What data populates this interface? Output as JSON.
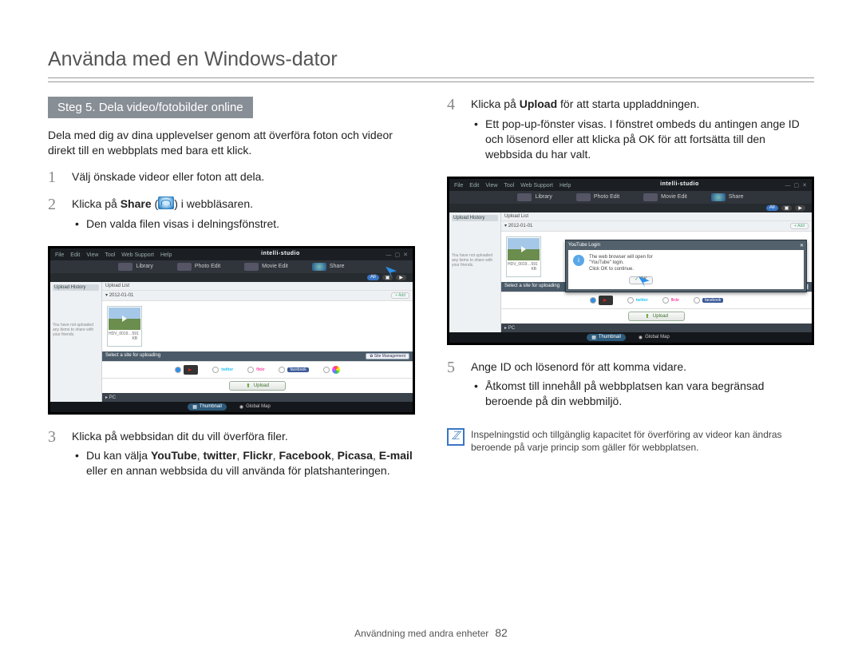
{
  "page_title": "Använda med en Windows-dator",
  "section_header": "Steg 5. Dela video/fotobilder online",
  "intro": "Dela med dig av dina upplevelser genom att överföra foton och videor direkt till en webbplats med bara ett klick.",
  "steps": {
    "s1": {
      "num": "1",
      "text": "Välj önskade videor eller foton att dela."
    },
    "s2": {
      "num": "2",
      "text_a": "Klicka på ",
      "bold": "Share",
      "text_b": " (",
      "text_c": ") i webbläsaren.",
      "bullet": "Den valda filen visas i delningsfönstret."
    },
    "s3": {
      "num": "3",
      "text": "Klicka på webbsidan dit du vill överföra filer.",
      "bullet_a": "Du kan välja ",
      "b_youtube": "YouTube",
      "c1": ", ",
      "b_twitter": "twitter",
      "c2": ", ",
      "b_flickr": "Flickr",
      "c3": ", ",
      "b_facebook": "Facebook",
      "c4": ", ",
      "b_picasa": "Picasa",
      "c5": ", ",
      "b_email": "E-mail",
      "tail": " eller en annan webbsida du vill använda för platshanteringen."
    },
    "s4": {
      "num": "4",
      "text_a": "Klicka på ",
      "bold": "Upload",
      "text_b": " för att starta uppladdningen.",
      "bullet": "Ett pop-up-fönster visas. I fönstret ombeds du antingen ange ID och lösenord eller att klicka på OK för att fortsätta till den webbsida du har valt."
    },
    "s5": {
      "num": "5",
      "text": "Ange ID och lösenord för att komma vidare.",
      "bullet": "Åtkomst till innehåll på webbplatsen kan vara begränsad beroende på din webbmiljö."
    }
  },
  "note": "Inspelningstid och tillgänglig kapacitet för överföring av videor kan ändras beroende på varje princip som gäller för webbplatsen.",
  "app": {
    "menus": [
      "File",
      "Edit",
      "View",
      "Tool",
      "Web Support",
      "Help"
    ],
    "logo": "intelli-studio",
    "tabs": {
      "library": "Library",
      "photo": "Photo Edit",
      "movie": "Movie Edit",
      "share": "Share"
    },
    "filter": {
      "all": "All"
    },
    "sidebar_title": "Upload History",
    "sidebar_msg": "You have not uploaded any items to share with your friends.",
    "upload_list": "Upload List",
    "date": "2012-01-01",
    "add": "Add",
    "thumb_name": "HDV_0019…",
    "thumb_size": "591 KB",
    "select_bar": "Select a site for uploading",
    "site_mgmt": "Site Management",
    "services": {
      "youtube": "YouTube",
      "twitter": "twitter",
      "flickr": "flickr",
      "facebook": "facebook",
      "picasa": "Picasa"
    },
    "upload_btn": "Upload",
    "pc": "PC",
    "thumbnail": "Thumbnail",
    "global": "Global Map",
    "popup_title": "YouTube Login",
    "popup_text1": "The web browser will open for",
    "popup_text2": "\"YouTube\" login.",
    "popup_text3": "Click OK to continue.",
    "popup_ok": "OK"
  },
  "footer": {
    "label": "Användning med andra enheter",
    "page": "82"
  }
}
